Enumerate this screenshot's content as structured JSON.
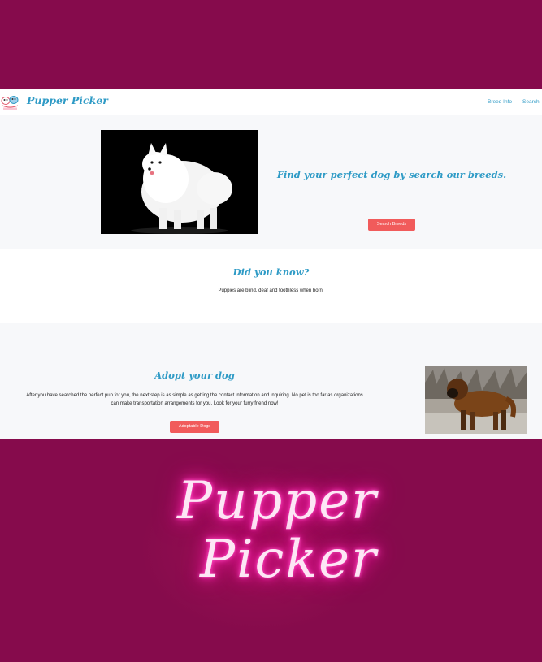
{
  "navbar": {
    "brand": "Pupper Picker",
    "links": [
      "Breed Info",
      "Search"
    ]
  },
  "hero": {
    "title": "Find your perfect dog by search our breeds.",
    "button": "Search Breeds"
  },
  "did_you_know": {
    "title": "Did you know?",
    "text": "Puppies are blind, deaf and toothless when born."
  },
  "adopt": {
    "title": "Adopt your dog",
    "text": "After you have searched the perfect pup for you, the next step is as simple as getting the contact information and inquiring. No pet is too far as organizations can make transportation arrangements for you. Look for your furry friend now!",
    "button": "Adoptable Dogs"
  },
  "neon_sign": {
    "line1": "Pupper",
    "line2": "Picker"
  },
  "colors": {
    "background": "#860b4c",
    "brand_blue": "#2f9bc6",
    "button_red": "#f15b5b",
    "neon_pink": "#ff2fb4"
  }
}
